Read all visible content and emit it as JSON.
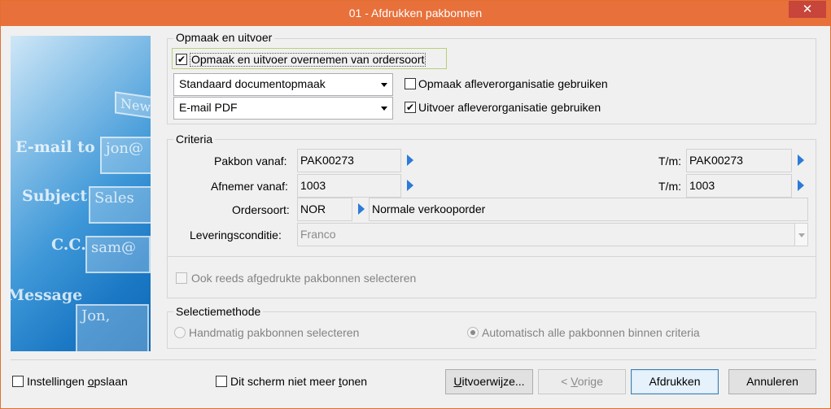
{
  "window": {
    "title": "01 - Afdrukken pakbonnen",
    "close_glyph": "✕",
    "accent_color": "#e8703a"
  },
  "side_image": {
    "new_label": "New",
    "email_label": "E-mail to",
    "email_value": "jon@",
    "subject_label": "Subject",
    "subject_value": "Sales",
    "cc_label": "C.C.",
    "cc_value": "sam@",
    "message_label": "Message",
    "message_value": "Jon,"
  },
  "opmaak": {
    "group_title": "Opmaak en uitvoer",
    "take_over_checkbox": {
      "label": "Opmaak en uitvoer overnemen van ordersoort",
      "checked": true
    },
    "layout_select": {
      "value": "Standaard documentopmaak"
    },
    "output_select": {
      "value": "E-mail PDF"
    },
    "use_delivery_layout": {
      "label": "Opmaak afleverorganisatie gebruiken",
      "checked": false
    },
    "use_delivery_output": {
      "label": "Uitvoer afleverorganisatie gebruiken",
      "checked": true
    },
    "check_glyph": "✔"
  },
  "criteria": {
    "group_title": "Criteria",
    "pakbon_from_label": "Pakbon vanaf:",
    "pakbon_from_value": "PAK00273",
    "pakbon_to_label": "T/m:",
    "pakbon_to_value": "PAK00273",
    "afnemer_from_label": "Afnemer vanaf:",
    "afnemer_from_value": "1003",
    "afnemer_to_label": "T/m:",
    "afnemer_to_value": "1003",
    "ordersoort_label": "Ordersoort:",
    "ordersoort_code": "NOR",
    "ordersoort_desc": "Normale verkooporder",
    "levering_label": "Leveringsconditie:",
    "levering_value": "Franco",
    "reprint_checkbox": {
      "label": "Ook reeds afgedrukte pakbonnen selecteren",
      "checked": false,
      "enabled": false
    }
  },
  "selectie": {
    "group_title": "Selectiemethode",
    "manual_option": {
      "label": "Handmatig pakbonnen selecteren",
      "selected": false
    },
    "auto_option": {
      "label": "Automatisch alle pakbonnen binnen criteria",
      "selected": true
    }
  },
  "footer": {
    "save_settings": {
      "label_pre": "Instellingen ",
      "label_ul": "o",
      "label_post": "psla",
      "label_end": "an",
      "checked": false
    },
    "dont_show": {
      "label_pre": "Dit scherm niet meer ",
      "label_ul": "t",
      "label_post": "onen",
      "checked": false
    },
    "uitvoerwijze_ul": "U",
    "uitvoerwijze_rest": "itvoerwijze...",
    "vorige_pre": "< ",
    "vorige_ul": "V",
    "vorige_rest": "orige",
    "afdrukken_label": "Afdrukken",
    "annuleren_label": "Annuleren"
  }
}
